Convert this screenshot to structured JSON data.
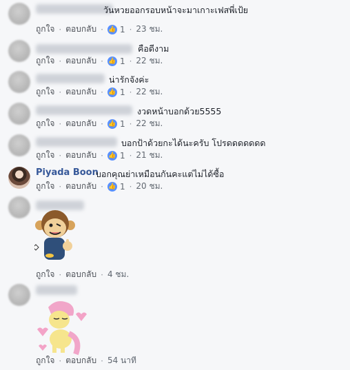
{
  "comments": [
    {
      "name": "",
      "text": "วันหวยออกรอบหน้าจะมาเกาะเฟสพี่เป้ย",
      "like_label": "ถูกใจ",
      "reply_label": "ตอบกลับ",
      "reactions": "1",
      "time": "23 ชม."
    },
    {
      "name": "",
      "text": "คือดีงาม",
      "like_label": "ถูกใจ",
      "reply_label": "ตอบกลับ",
      "reactions": "1",
      "time": "22 ชม."
    },
    {
      "name": "",
      "text": "น่ารักจังค่ะ",
      "like_label": "ถูกใจ",
      "reply_label": "ตอบกลับ",
      "reactions": "1",
      "time": "22 ชม."
    },
    {
      "name": "",
      "text": "งวดหน้าบอกด้วย5555",
      "like_label": "ถูกใจ",
      "reply_label": "ตอบกลับ",
      "reactions": "1",
      "time": "22 ชม."
    },
    {
      "name": "",
      "text": "บอกป้าด้วยกะได้นะครับ โปรดดดดดดด",
      "like_label": "ถูกใจ",
      "reply_label": "ตอบกลับ",
      "reactions": "1",
      "time": "21 ชม."
    },
    {
      "name": "Piyada Boon",
      "text": "บอกคุณย่าเหมือนกันคะแต่ไม่ได้ซื้อ",
      "like_label": "ถูกใจ",
      "reply_label": "ตอบกลับ",
      "reactions": "1",
      "time": "20 ชม."
    },
    {
      "name": "",
      "text": "",
      "like_label": "ถูกใจ",
      "reply_label": "ตอบกลับ",
      "reactions": "",
      "time": "4 ชม."
    },
    {
      "name": "",
      "text": "",
      "like_label": "ถูกใจ",
      "reply_label": "ตอบกลับ",
      "reactions": "",
      "time": "54 นาที"
    }
  ],
  "icons": {
    "like": "thumbs-up-icon",
    "sticker1": "monkey-thumbs-up-sticker",
    "sticker2": "pink-pony-sticker"
  },
  "colors": {
    "background": "#f6f7f9",
    "name": "#365899",
    "like_badge": "#5890ff"
  }
}
